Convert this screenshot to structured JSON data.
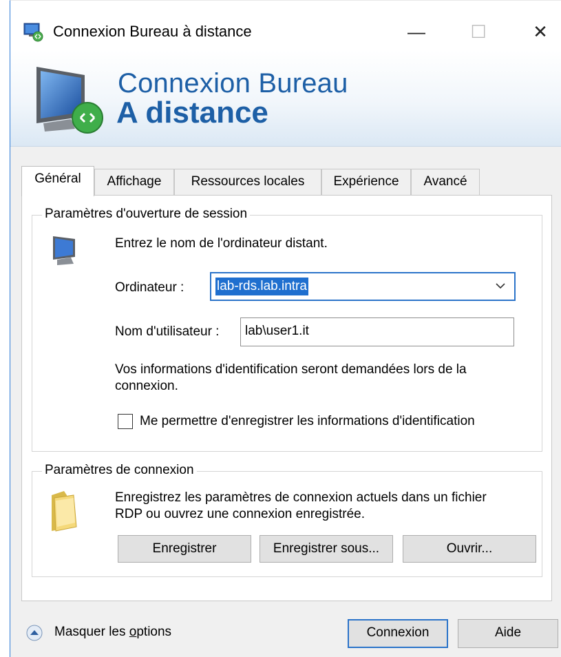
{
  "window": {
    "title": "Connexion Bureau à distance",
    "controls": {
      "minimize": "—",
      "maximize": "☐",
      "close": "✕"
    }
  },
  "banner": {
    "line1": "Connexion Bureau",
    "line2": "A distance"
  },
  "tabs": [
    {
      "label": "Général",
      "active": true
    },
    {
      "label": "Affichage",
      "active": false
    },
    {
      "label": "Ressources locales",
      "active": false
    },
    {
      "label": "Expérience",
      "active": false
    },
    {
      "label": "Avancé",
      "active": false
    }
  ],
  "logon": {
    "group_title": "Paramètres d'ouverture de session",
    "intro": "Entrez le nom de l'ordinateur distant.",
    "computer_label": "Ordinateur :",
    "computer_value": "lab-rds.lab.intra",
    "user_label": "Nom d'utilisateur :",
    "user_value": "lab\\user1.it",
    "info": "Vos informations d'identification seront demandées lors de la connexion.",
    "save_credentials_label": "Me permettre d'enregistrer les informations d'identification",
    "save_credentials_checked": false
  },
  "connection": {
    "group_title": "Paramètres de connexion",
    "description": "Enregistrez les paramètres de connexion actuels dans un fichier RDP ou ouvrez une connexion enregistrée.",
    "save_label": "Enregistrer",
    "save_as_label": "Enregistrer sous...",
    "open_label": "Ouvrir..."
  },
  "footer": {
    "toggle_prefix": "Masquer les ",
    "toggle_accel": "o",
    "toggle_suffix": "ptions",
    "connect_label": "Connexion",
    "help_label": "Aide"
  },
  "colors": {
    "accent": "#2a73c9",
    "banner_text": "#1d5fa6",
    "selection": "#1f6fcf"
  }
}
